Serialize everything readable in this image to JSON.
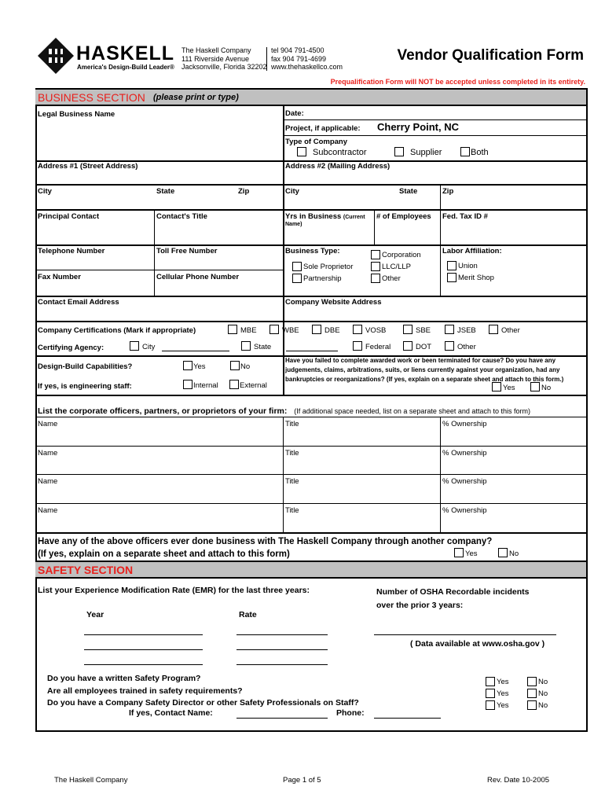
{
  "header": {
    "logo_text": "HASKELL",
    "tagline": "America's Design-Build Leader®",
    "company": "The Haskell Company",
    "address1": "111 Riverside Avenue",
    "address2": "Jacksonville, Florida 32202",
    "tel": "tel  904 791-4500",
    "fax": "fax  904 791-4699",
    "web": "www.thehaskellco.com",
    "title": "Vendor Qualification Form",
    "notice": "Prequalification Form will NOT be accepted unless completed in its entirety."
  },
  "business": {
    "section": "BUSINESS SECTION",
    "section_note": "(please print or type)",
    "legal_name": "Legal Business Name",
    "date": "Date:",
    "project": "Project, if applicable:",
    "project_value": "Cherry Point, NC",
    "type_of_company": "Type of Company",
    "subcontractor": "Subcontractor",
    "supplier": "Supplier",
    "both": "Both",
    "address1": "Address #1 (Street Address)",
    "address2": "Address #2 (Mailing Address)",
    "city": "City",
    "state": "State",
    "zip": "Zip",
    "principal": "Principal Contact",
    "contact_title": "Contact's Title",
    "yrs": "Yrs in Business",
    "yrs_small": "(Current",
    "yrs_name": "Name)",
    "employees": "# of Employees",
    "taxid": "Fed. Tax ID #",
    "telephone": "Telephone Number",
    "tollfree": "Toll Free Number",
    "fax": "Fax Number",
    "cell": "Cellular Phone Number",
    "business_type": "Business Type:",
    "corporation": "Corporation",
    "sole": "Sole Proprietor",
    "llc": "LLC/LLP",
    "partnership": "Partnership",
    "other": "Other",
    "labor": "Labor Affiliation:",
    "union": "Union",
    "merit": "Merit Shop",
    "email": "Contact Email Address",
    "website": "Company Website Address",
    "certs": "Company Certifications (Mark if appropriate)",
    "cert_options": [
      "MBE",
      "WBE",
      "DBE",
      "VOSB",
      "SBE",
      "JSEB",
      "Other"
    ],
    "agency": "Certifying Agency:",
    "agency_options": [
      "City",
      "State",
      "Federal",
      "DOT",
      "Other"
    ],
    "db": "Design-Build Capabilities?",
    "yes": "Yes",
    "no": "No",
    "eng": "If yes, is engineering staff:",
    "internal": "Internal",
    "external": "External",
    "failed_q": [
      "Have you failed to complete awarded work or been terminated for cause?  Do you have any",
      "judgements, claims, arbitrations, suits, or liens currently against your organization, had any",
      "bankruptcies or reorganizations?  (If yes, explain on a separate sheet and attach to this form.)"
    ],
    "officers": "List the corporate officers, partners, or proprietors of your firm:",
    "officers_note": "(If additional space needed, list on a separate sheet and attach to this form)",
    "name": "Name",
    "title": "Title",
    "ownership": "% Ownership",
    "other_co_q1": "Have any of the above officers ever done business with The Haskell Company through another company?",
    "other_co_q2": "(If yes, explain on a separate sheet and attach to this form)"
  },
  "safety": {
    "section": "SAFETY SECTION",
    "emr": "List your Experience Modification Rate (EMR) for the last three years:",
    "osha1": "Number of OSHA Recordable incidents",
    "osha2": "over the prior 3 years:",
    "year": "Year",
    "rate": "Rate",
    "osha_note": "( Data available at www.osha.gov )",
    "q1": "Do you have a written Safety Program?",
    "q2": "Are all employees trained in safety requirements?",
    "q3": "Do you have a Company Safety Director or other Safety Professionals on Staff?",
    "contact": "If yes,  Contact Name:",
    "phone": "Phone:",
    "yes": "Yes",
    "no": "No"
  },
  "footer": {
    "left": "The Haskell Company",
    "center": "Page 1 of 5",
    "right": "Rev. Date 10-2005"
  }
}
